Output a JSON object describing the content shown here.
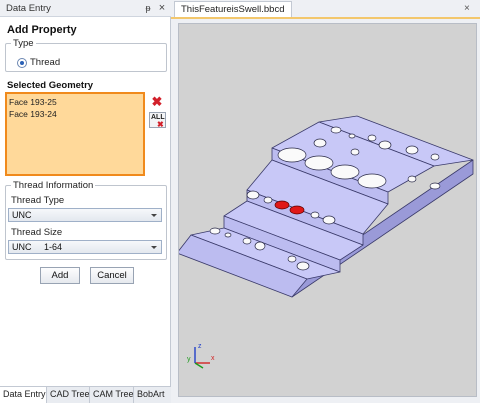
{
  "left_pane": {
    "title": "Data Entry",
    "pin_glyph": "ᵽ",
    "close_glyph": "×",
    "heading": "Add Property",
    "type_group": {
      "legend": "Type",
      "option_label": "Thread"
    },
    "selected_geometry": {
      "label": "Selected Geometry",
      "items": [
        "Face 193-25",
        "Face 193-24"
      ],
      "all_label": "ALL"
    },
    "thread_info": {
      "legend": "Thread Information",
      "type_label": "Thread Type",
      "type_value": "UNC",
      "size_label": "Thread Size",
      "size_value": "UNC     1-64"
    },
    "buttons": {
      "add": "Add",
      "cancel": "Cancel"
    },
    "tabs": [
      "Data Entry",
      "CAD Tree",
      "CAM Tree",
      "BobArt"
    ]
  },
  "document": {
    "tab_title": "ThisFeatureisSwell.bbcd",
    "close_glyph": "×",
    "axes": {
      "x": "x",
      "y": "y",
      "z": "z"
    }
  },
  "colors": {
    "selection_fill": "#ffd99a",
    "selection_border": "#f08a1c",
    "model_top": "#c8c8f7",
    "model_front": "#bcbcf0",
    "model_side": "#9a9ad8",
    "highlight_red": "#e01818"
  }
}
